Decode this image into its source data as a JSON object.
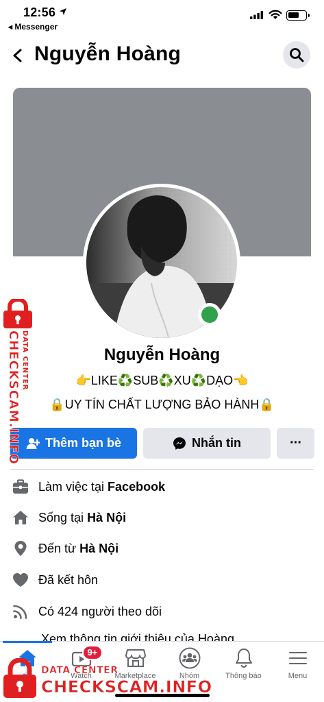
{
  "status_bar": {
    "time": "12:56",
    "back_app": "◂ Messenger",
    "icons": [
      "location-arrow-icon",
      "cellular-signal-icon",
      "wifi-icon",
      "battery-icon"
    ]
  },
  "header": {
    "title": "Nguyễn Hoàng",
    "icons": [
      "back-chevron-icon",
      "search-icon"
    ]
  },
  "profile": {
    "name": "Nguyễn Hoàng",
    "bio_line_1": "👉LIKE♻️SUB♻️XU♻️DẠO👈",
    "bio_line_2": "🔒UY TÍN CHẤT LƯỢNG BẢO HÀNH🔒",
    "online_status_color": "#31a24c",
    "cover_color": "#8a8d91"
  },
  "actions": {
    "add_friend_label": "Thêm bạn bè",
    "message_label": "Nhắn tin",
    "more_label": "···",
    "primary_color": "#1b74e4",
    "secondary_color": "#e4e6eb"
  },
  "details": {
    "work_prefix": "Làm việc tại",
    "work_value": "Facebook",
    "live_prefix": "Sống tại",
    "live_value": "Hà Nội",
    "from_prefix": "Đến từ",
    "from_value": "Hà Nội",
    "relationship": "Đã kết hôn",
    "followers": "Có 424 người theo dõi",
    "see_about": "Xem thông tin giới thiệu của Hoàng"
  },
  "tab_bar": {
    "tabs": [
      {
        "label": "tin",
        "icon": "home-icon"
      },
      {
        "label": "Watch",
        "icon": "watch-video-icon"
      },
      {
        "label": "Marketplace",
        "icon": "marketplace-shop-icon"
      },
      {
        "label": "Nhóm",
        "icon": "groups-icon"
      },
      {
        "label": "Thông báo",
        "icon": "bell-icon"
      },
      {
        "label": "Menu",
        "icon": "hamburger-menu-icon"
      }
    ],
    "watch_badge": "9+",
    "active_color": "#1b74e4",
    "badge_color": "#e41e3f"
  },
  "watermark": {
    "brand": "CHECKSCAM.INFO",
    "tagline": "DATA CENTER",
    "color": "#e02020"
  }
}
